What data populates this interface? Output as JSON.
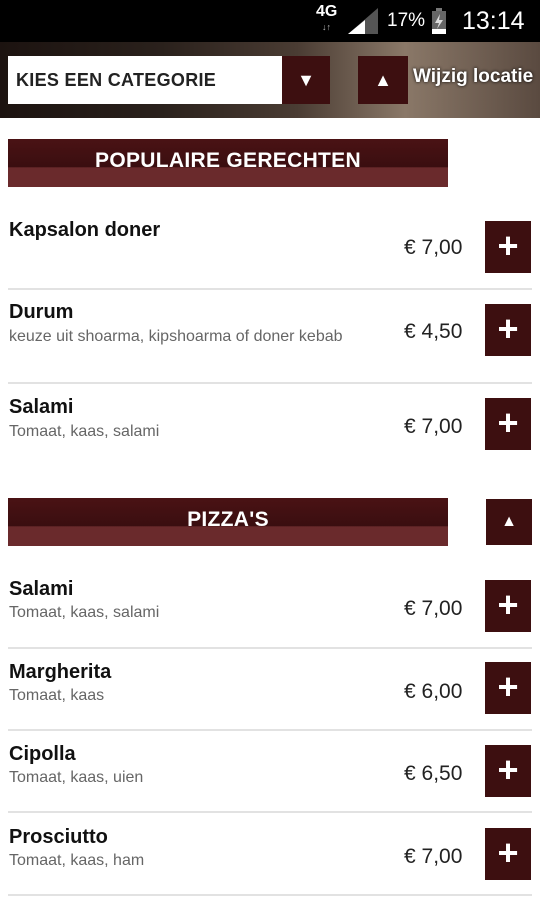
{
  "status_bar": {
    "network": "4G",
    "network_sub": "↓↑",
    "battery_percent": "17%",
    "time": "13:14"
  },
  "header": {
    "category_select": {
      "label": "KIES EEN CATEGORIE",
      "icon": "triangle-down-icon"
    },
    "location_button": {
      "label": "Wijzig locatie",
      "icon": "triangle-up-icon"
    }
  },
  "sections": [
    {
      "title": "POPULAIRE GERECHTEN",
      "items": [
        {
          "name": "Kapsalon doner",
          "description": "",
          "price": "€ 7,00"
        },
        {
          "name": "Durum",
          "description": "keuze uit shoarma, kipshoarma of doner kebab",
          "price": "€ 4,50"
        },
        {
          "name": "Salami",
          "description": "Tomaat, kaas, salami",
          "price": "€ 7,00"
        }
      ]
    },
    {
      "title": "PIZZA'S",
      "collapse_icon": "triangle-up-icon",
      "items": [
        {
          "name": "Salami",
          "description": "Tomaat, kaas, salami",
          "price": "€ 7,00"
        },
        {
          "name": "Margherita",
          "description": "Tomaat, kaas",
          "price": "€ 6,00"
        },
        {
          "name": "Cipolla",
          "description": "Tomaat, kaas, uien",
          "price": "€ 6,50"
        },
        {
          "name": "Prosciutto",
          "description": "Tomaat, kaas, ham",
          "price": "€ 7,00"
        }
      ]
    }
  ],
  "add_button_symbol": "+",
  "colors": {
    "accent": "#3d0f10",
    "banner_light": "#6a2a2c",
    "description_text": "#666666",
    "divider": "#e2e2e2"
  }
}
